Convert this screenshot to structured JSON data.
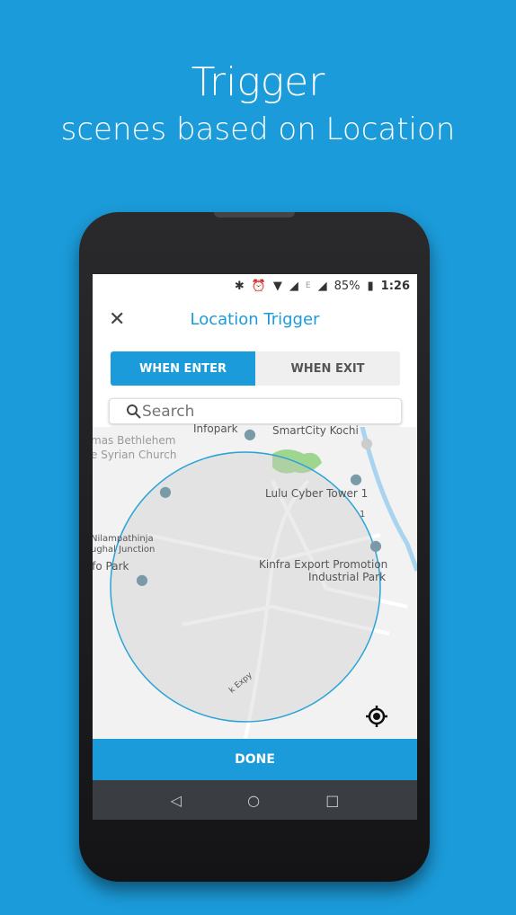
{
  "promo": {
    "title": "Trigger",
    "subtitle": "scenes based on Location"
  },
  "status": {
    "battery": "85%",
    "time": "1:26",
    "network": "E"
  },
  "header": {
    "title": "Location Trigger"
  },
  "tabs": [
    {
      "label": "WHEN ENTER",
      "selected": true
    },
    {
      "label": "WHEN EXIT",
      "selected": false
    }
  ],
  "search": {
    "placeholder": "Search"
  },
  "map": {
    "labels": [
      "mas Bethlehem",
      "e Syrian Church",
      "Infopark",
      "SmartCity Kochi",
      "Lulu Cyber Tower 1",
      "Nilampathinja",
      "ughal Junction",
      "Kinfra Export Promotion",
      "Industrial Park",
      "Info Park",
      "1",
      "k Expy"
    ],
    "circle_color": "#2aa3d8"
  },
  "done_label": "DONE",
  "colors": {
    "accent": "#1b9bd9",
    "background": "#1b9bd9"
  }
}
